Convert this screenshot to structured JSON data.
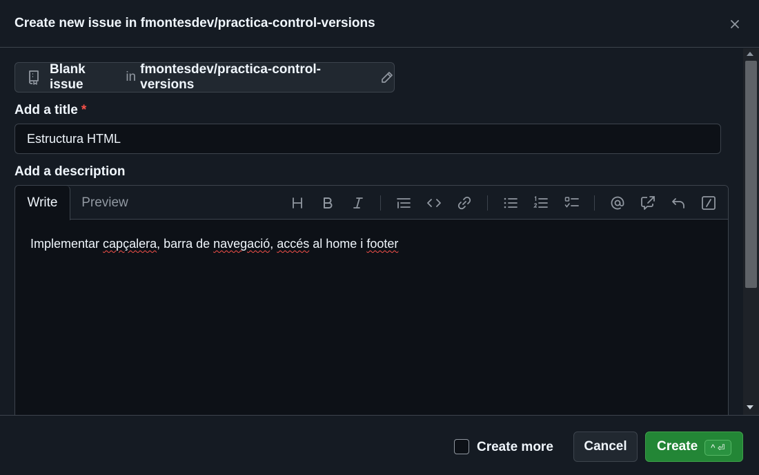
{
  "header": {
    "title": "Create new issue in fmontesdev/practica-control-versions"
  },
  "template": {
    "name": "Blank issue",
    "connector": "in",
    "repo": "fmontesdev/practica-control-versions"
  },
  "title_field": {
    "label": "Add a title",
    "required_mark": "*",
    "value": "Estructura HTML"
  },
  "description": {
    "label": "Add a description",
    "tabs": [
      {
        "label": "Write",
        "active": true
      },
      {
        "label": "Preview",
        "active": false
      }
    ],
    "toolbar_icons": [
      "heading-icon",
      "bold-icon",
      "italic-icon",
      "quote-icon",
      "code-icon",
      "link-icon",
      "unordered-list-icon",
      "ordered-list-icon",
      "task-list-icon",
      "mention-icon",
      "reference-icon",
      "undo-icon",
      "slash-commands-icon"
    ],
    "text_parts": [
      "Implementar ",
      "capçalera",
      ", barra de ",
      "navegació",
      ", ",
      "accés",
      " al home i ",
      "footer"
    ]
  },
  "footer": {
    "create_more_label": "Create more",
    "create_more_checked": false,
    "cancel_label": "Cancel",
    "create_label": "Create",
    "create_shortcut": "^ ⏎"
  },
  "colors": {
    "primary_button": "#238636",
    "background": "#151b23",
    "editor_background": "#0d1117",
    "border": "#3d444d",
    "required": "#f85149"
  }
}
